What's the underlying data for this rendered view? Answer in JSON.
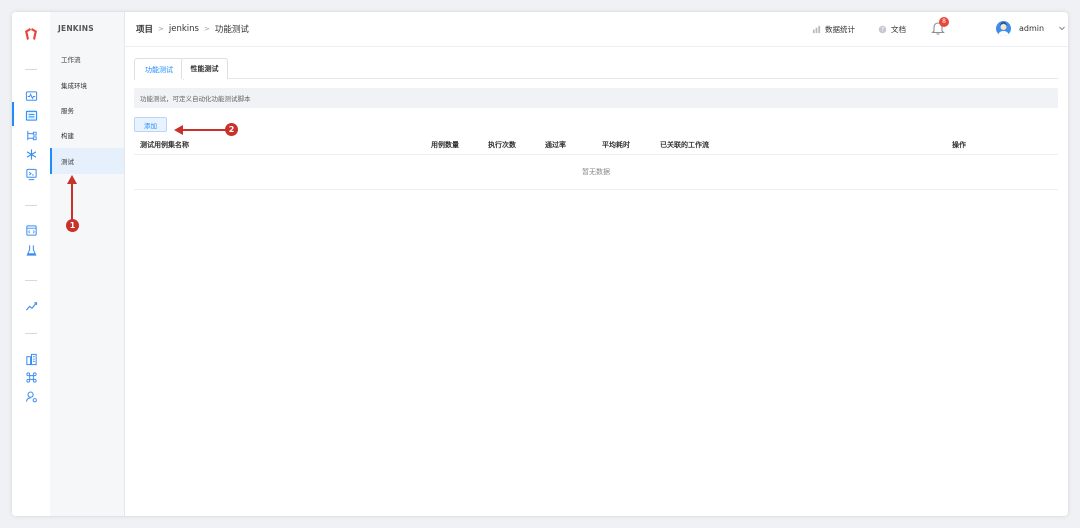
{
  "sidebar": {
    "title": "JENKINS",
    "items": [
      {
        "label": "工作流"
      },
      {
        "label": "集成环境"
      },
      {
        "label": "服务"
      },
      {
        "label": "构建"
      },
      {
        "label": "测试"
      }
    ]
  },
  "rail": {
    "icons": [
      "monitor-icon",
      "folder-icon",
      "tree-icon",
      "snowflake-icon",
      "screen-icon",
      "code-window-icon",
      "flask-icon",
      "analytics-icon",
      "building-icon",
      "command-icon",
      "user-settings-icon"
    ]
  },
  "header": {
    "breadcrumb": [
      "项目",
      "jenkins",
      "功能测试"
    ],
    "breadcrumb_sep": ">",
    "stats_label": "数据统计",
    "docs_label": "文档",
    "notification_count": "8",
    "username": "admin"
  },
  "tabs": [
    {
      "label": "功能测试",
      "active": true
    },
    {
      "label": "性能测试",
      "active": false
    }
  ],
  "description": "功能测试，可定义自动化功能测试脚本",
  "add_button": "添加",
  "table": {
    "columns": [
      "测试用例集名称",
      "用例数量",
      "执行次数",
      "通过率",
      "平均耗时",
      "已关联的工作流",
      "操作"
    ],
    "empty_text": "暂无数据"
  },
  "annotations": {
    "marker1": "1",
    "marker2": "2"
  },
  "colors": {
    "accent": "#1e8bff",
    "annotation": "#c8322a",
    "badge": "#e8473a"
  }
}
